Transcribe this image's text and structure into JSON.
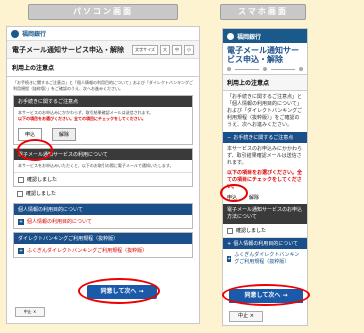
{
  "labels": {
    "pc": "パソコン画面",
    "sp": "スマホ画面"
  },
  "pc": {
    "logo": "福岡銀行",
    "title": "電子メール通知サービス申込・解除",
    "head_buttons": [
      "文字サイズ",
      "大",
      "中",
      "小"
    ],
    "section": "利用上の注意点",
    "intro": "「お手続きに関するご注意点」と「個人情報の利用目的について」および「ダイレクトバンキングご利用規程（抜粋版）」をご確認のうえ、次へお進みください。",
    "box1_title": "お手続きに関するご注意点",
    "box1_text": "本サービスのお申込みにかかわらず、取引結果確認メールは送信されます。",
    "box1_red": "以下の項目をお選びください。全ての項目にチェックをしてください。",
    "choice_selected": "申込",
    "choice_other": "解除",
    "box2_title": "電子メール通知サービスの利用について",
    "box2_text": "本サービスをお申込みいただくと、以下のお取引の際に電子メールで通知いたします。",
    "check1": "確認しました",
    "check2": "確認しました",
    "personal_title": "個人情報の利用目的について",
    "personal_link": "個人情報の利用目的について",
    "terms_title": "ダイレクトバンキングご利用規程（抜粋版）",
    "terms_link": "ふくぎんダイレクトバンキングご利用規程（抜粋版）",
    "agree": "同意して次へ →",
    "cancel": "中止 ×"
  },
  "sp": {
    "logo": "福岡銀行",
    "title": "電子メール通知サービス申込・解除",
    "section": "利用上の注意点",
    "intro": "「お手続きに関するご注意点」と「個人情報の利用目的について」および「ダイレクトバンキングご利用規程（抜粋版）」をご確認のうえ、次へお進みください。",
    "bar1": "お手続きに関するご注意点",
    "text1": "本サービスのお申込みにかかわらず、取引結果確認メールは送信されます。",
    "red1": "以下の項目をお選びください。全ての項目にチェックをしてください。",
    "choice_selected": "申込",
    "choice_other": "解除",
    "dark_bar": "電子メール通知サービスのお申込方法について",
    "check": "確認しました",
    "bar2": "個人情報の利用目的について",
    "link2": "ふくぎんダイレクトバンキングご利用規程（抜粋版）",
    "agree": "同意して次へ →",
    "cancel": "中止 ×"
  },
  "colors": {
    "highlight": "#ee0000",
    "brand": "#1a5aa8",
    "background": "#fdf3d0"
  }
}
